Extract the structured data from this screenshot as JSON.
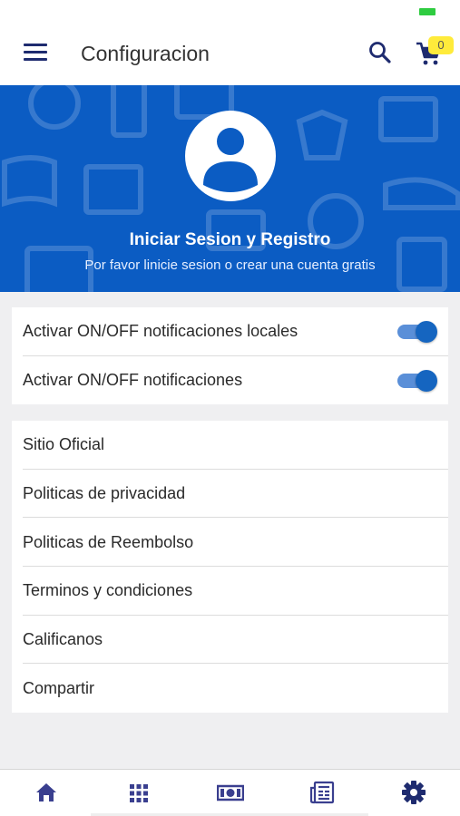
{
  "app": {
    "title": "Configuracion",
    "cart_count": "0",
    "colors": {
      "primary": "#0b5cc3",
      "navy": "#1e2b6f",
      "toggle_on": "#1565c0",
      "badge": "#ffeb3b"
    }
  },
  "icons": {
    "menu": "menu-icon",
    "search": "search-icon",
    "cart": "cart-icon",
    "avatar": "user-avatar-icon"
  },
  "hero": {
    "title": "Iniciar Sesion y Registro",
    "subtitle": "Por favor linicie sesion o crear una cuenta gratis"
  },
  "toggles": [
    {
      "label": "Activar ON/OFF notificaciones locales",
      "on": true
    },
    {
      "label": "Activar ON/OFF notificaciones",
      "on": true
    }
  ],
  "links": [
    {
      "label": "Sitio Oficial"
    },
    {
      "label": "Politicas de privacidad"
    },
    {
      "label": "Politicas de Reembolso"
    },
    {
      "label": "Terminos y condiciones"
    },
    {
      "label": "Calificanos"
    },
    {
      "label": "Compartir"
    }
  ],
  "bottom_nav": [
    {
      "icon": "home-icon",
      "active": false
    },
    {
      "icon": "grid-icon",
      "active": false
    },
    {
      "icon": "money-icon",
      "active": false
    },
    {
      "icon": "news-icon",
      "active": false
    },
    {
      "icon": "settings-icon",
      "active": true
    }
  ]
}
